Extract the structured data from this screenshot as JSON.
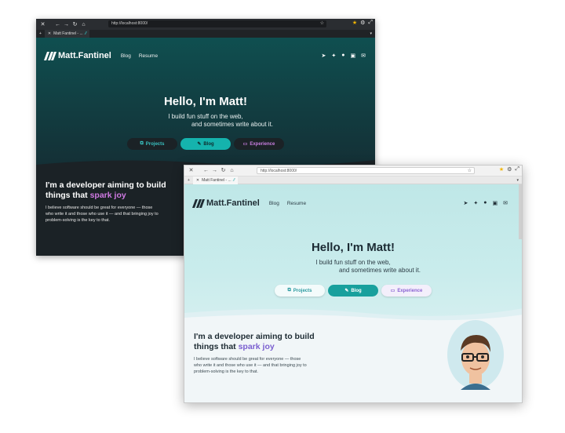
{
  "url": "http://localhost:8000/",
  "tab_title": "Matt Fantinel - ...",
  "logo_text": "Matt.Fantinel",
  "nav": [
    "Blog",
    "Resume"
  ],
  "hero": {
    "title": "Hello, I'm Matt!",
    "line1": "I build fun stuff on the web,",
    "line2": "and sometimes write about it."
  },
  "buttons": [
    "Projects",
    "Blog",
    "Experience"
  ],
  "about": {
    "title_prefix": "I'm a developer aiming to build",
    "title_middle": "things that",
    "accent": "spark joy",
    "body_dark_1": "I believe software should be great for everyone — those",
    "body_dark_2": "who write it and those who use it — and that bringing joy to",
    "body_dark_3": "problem-solving is the key to that.",
    "body_light_1": "I believe software should be great for everyone — those",
    "body_light_2": "who write it and those who use it — and that bringing joy to",
    "body_light_3": "problem-solving is the key to that."
  },
  "social_icons": [
    "telegram-icon",
    "twitter-icon",
    "github-icon",
    "linkedin-icon",
    "email-icon"
  ],
  "colors": {
    "dark_teal": "#0f4f50",
    "light_teal": "#bfe7e7",
    "accent_dark": "#d07ae3",
    "accent_light": "#7a5fd0",
    "blog_button": "#18a09d"
  }
}
